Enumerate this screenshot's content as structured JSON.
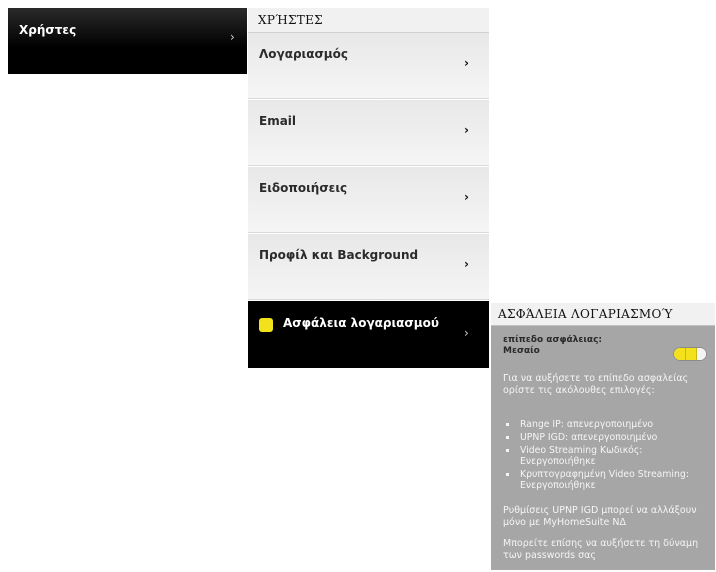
{
  "nav": {
    "label": "Χρήστες",
    "chevron": "›"
  },
  "menu": {
    "header": "ΧΡΉΣΤΕΣ",
    "items": [
      {
        "label": "Λογαριασμός",
        "chevron": "›"
      },
      {
        "label": "Email",
        "chevron": "›"
      },
      {
        "label": "Ειδοποιήσεις",
        "chevron": "›"
      },
      {
        "label": "Προφίλ και Background",
        "chevron": "›"
      },
      {
        "label": "Ασφάλεια λογαριασμού",
        "chevron": "›",
        "active": true
      }
    ]
  },
  "security": {
    "header": "ΑΣΦΆΛΕΙΑ ΛΟΓΑΡΙΑΣΜΟΎ",
    "level_title": "επίπεδο ασφάλειας:",
    "level_value": "Μεσαίο",
    "level_meter": {
      "filled": 2,
      "total": 3
    },
    "intro": "Για να αυξήσετε το επίπεδο ασφαλείας ορίστε τις ακόλουθες επιλογές:",
    "bullets": [
      "Range IP: απενεργοποιημένο",
      "UPNP IGD: απενεργοποιημένο",
      "Video Streaming Κωδικός: Ενεργοποιήθηκε",
      "Κρυπτογραφημένη Video Streaming: Ενεργοποιήθηκε"
    ],
    "note1": "Ρυθμίσεις UPNP IGD μπορεί να αλλάξουν μόνο με MyHomeSuite ΝΔ",
    "note2": "Μπορείτε επίσης να αυξήσετε τη δύναμη των passwords σας"
  },
  "colors": {
    "accent": "#f3e11c",
    "active_bg": "#000000",
    "panel_bg": "#a6a6a6"
  },
  "icons": {
    "status_dot": "yellow-status-icon",
    "chevron": "chevron-right-icon"
  }
}
